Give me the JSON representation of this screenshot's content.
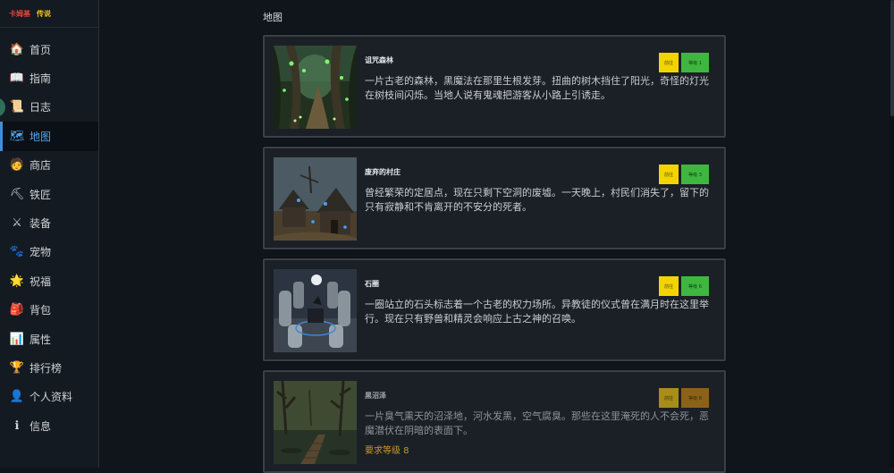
{
  "brand": {
    "part1": "卡姆基",
    "part2": "传说"
  },
  "sidebar": {
    "items": [
      {
        "label": "首页",
        "icon": "house-icon",
        "glyph": "🏠"
      },
      {
        "label": "指南",
        "icon": "book-icon",
        "glyph": "📖"
      },
      {
        "label": "日志",
        "icon": "scroll-icon",
        "glyph": "📜"
      },
      {
        "label": "地图",
        "icon": "map-icon",
        "glyph": "🗺"
      },
      {
        "label": "商店",
        "icon": "merchant-icon",
        "glyph": "🧑"
      },
      {
        "label": "铁匠",
        "icon": "hammer-icon",
        "glyph": "⛏"
      },
      {
        "label": "装备",
        "icon": "crossed-swords-icon",
        "glyph": "⚔"
      },
      {
        "label": "宠物",
        "icon": "paw-icon",
        "glyph": "🐾"
      },
      {
        "label": "祝福",
        "icon": "sparkle-icon",
        "glyph": "🌟"
      },
      {
        "label": "背包",
        "icon": "backpack-icon",
        "glyph": "🎒"
      },
      {
        "label": "属性",
        "icon": "bar-chart-icon",
        "glyph": "📊"
      },
      {
        "label": "排行榜",
        "icon": "trophy-icon",
        "glyph": "🏆"
      },
      {
        "label": "个人资料",
        "icon": "user-icon",
        "glyph": "👤"
      },
      {
        "label": "信息",
        "icon": "info-icon",
        "glyph": "ℹ"
      }
    ],
    "active_index": 3
  },
  "main": {
    "title": "地图",
    "locations": [
      {
        "name": "诅咒森林",
        "description": "一片古老的森林，黑魔法在那里生根发芽。扭曲的树木挡住了阳光，奇怪的灯光在树枝间闪烁。当地人说有鬼魂把游客从小路上引诱走。",
        "move_label": "前往",
        "level_label": "等级 1",
        "locked": false
      },
      {
        "name": "废弃的村庄",
        "description": "曾经繁荣的定居点，现在只剩下空洞的废墟。一天晚上，村民们消失了，留下的只有寂静和不肯离开的不安分的死者。",
        "move_label": "前往",
        "level_label": "等级 3",
        "locked": false
      },
      {
        "name": "石圈",
        "description": "一圈站立的石头标志着一个古老的权力场所。异教徒的仪式曾在满月时在这里举行。现在只有野兽和精灵会响应上古之神的召唤。",
        "move_label": "前往",
        "level_label": "等级 6",
        "locked": false
      },
      {
        "name": "黑沼泽",
        "description": "一片臭气熏天的沼泽地，河水发黑，空气腐臭。那些在这里淹死的人不会死，恶魔潜伏在阴暗的表面下。",
        "move_label": "前往",
        "level_label": "等级 8",
        "locked": true,
        "requirement": "要求等级 8"
      }
    ]
  },
  "colors": {
    "background": "#10151c",
    "sidebar": "#141a22",
    "active_nav": "#58a6e8",
    "move_button": "#f3d400",
    "level_button": "#3fb63f",
    "requirement": "#c9952c"
  }
}
